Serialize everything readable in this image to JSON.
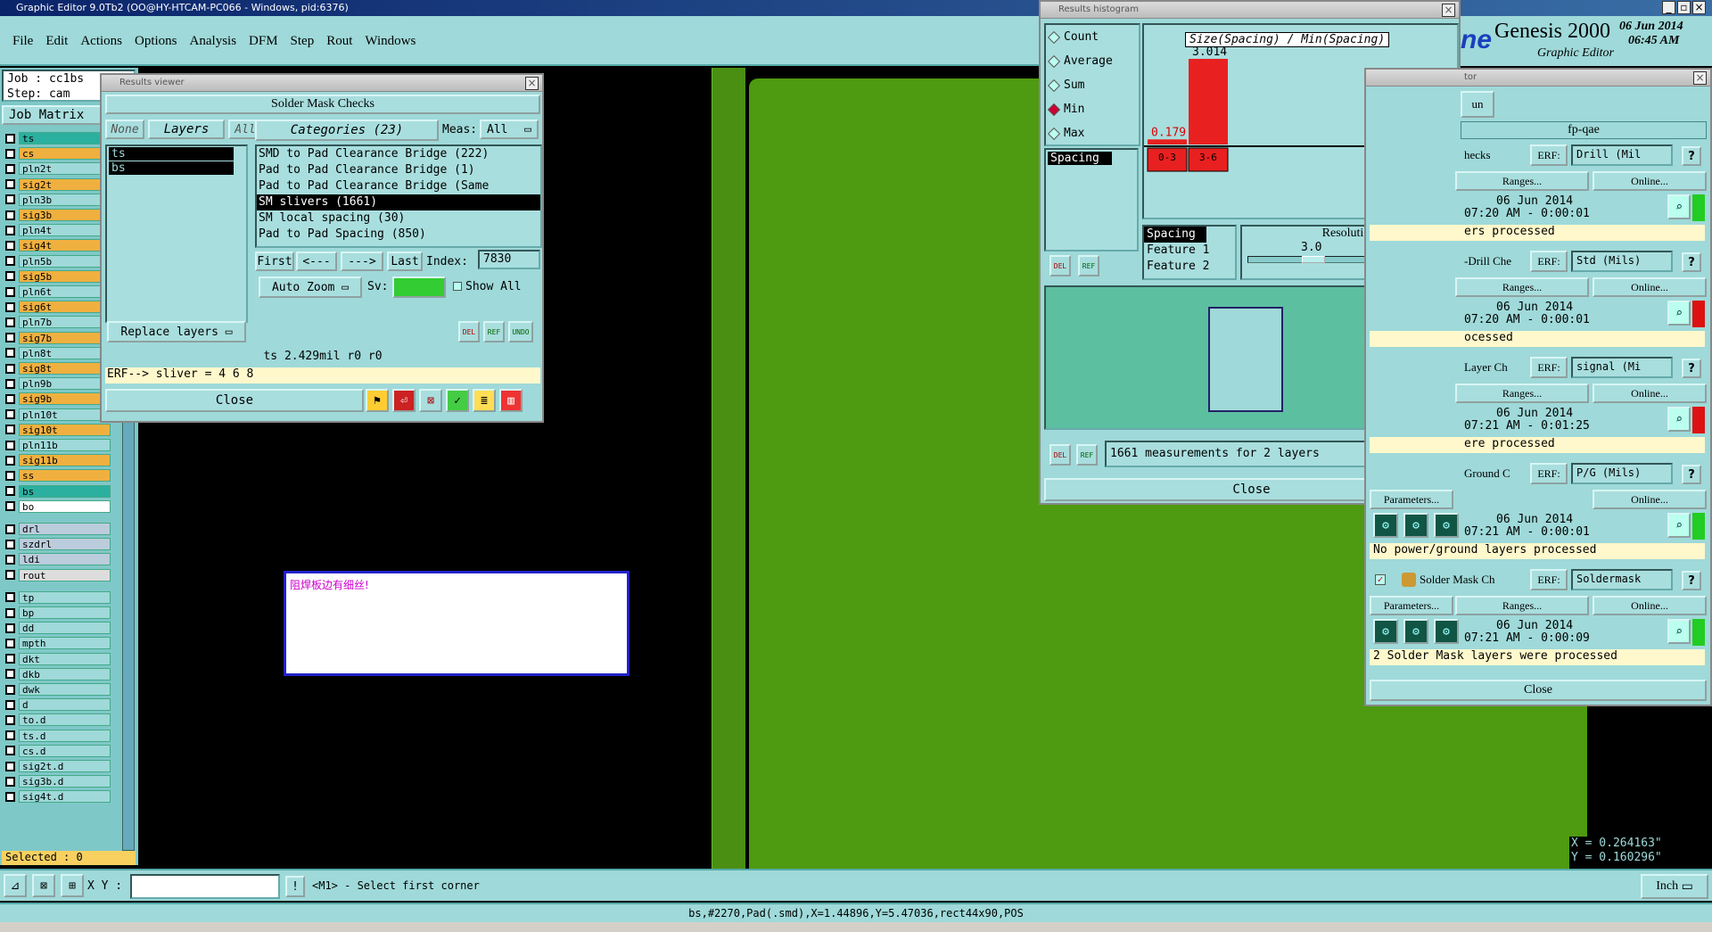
{
  "app_title": "Graphic Editor 9.0Tb2  (OO@HY-HTCAM-PC066 - Windows, pid:6376)",
  "menu": [
    "File",
    "Edit",
    "Actions",
    "Options",
    "Analysis",
    "DFM",
    "Step",
    "Rout",
    "Windows"
  ],
  "job": {
    "job_label": "Job : cc1bs",
    "step_label": "Step: cam",
    "matrix": "Job Matrix"
  },
  "layers": [
    {
      "name": "ts",
      "color": "#2bb0a0"
    },
    {
      "name": "cs",
      "color": "#f0b040"
    },
    {
      "name": "pln2t",
      "color": "#9fd9d9"
    },
    {
      "name": "sig2t",
      "color": "#f0b040"
    },
    {
      "name": "pln3b",
      "color": "#9fd9d9"
    },
    {
      "name": "sig3b",
      "color": "#f0b040"
    },
    {
      "name": "pln4t",
      "color": "#9fd9d9"
    },
    {
      "name": "sig4t",
      "color": "#f0b040"
    },
    {
      "name": "pln5b",
      "color": "#9fd9d9"
    },
    {
      "name": "sig5b",
      "color": "#f0b040"
    },
    {
      "name": "pln6t",
      "color": "#9fd9d9"
    },
    {
      "name": "sig6t",
      "color": "#f0b040"
    },
    {
      "name": "pln7b",
      "color": "#9fd9d9"
    },
    {
      "name": "sig7b",
      "color": "#f0b040"
    },
    {
      "name": "pln8t",
      "color": "#9fd9d9"
    },
    {
      "name": "sig8t",
      "color": "#f0b040"
    },
    {
      "name": "pln9b",
      "color": "#9fd9d9"
    },
    {
      "name": "sig9b",
      "color": "#f0b040"
    },
    {
      "name": "pln10t",
      "color": "#9fd9d9"
    },
    {
      "name": "sig10t",
      "color": "#f0b040"
    },
    {
      "name": "pln11b",
      "color": "#9fd9d9"
    },
    {
      "name": "sig11b",
      "color": "#f0b040"
    },
    {
      "name": "ss",
      "color": "#f0b040"
    },
    {
      "name": "bs",
      "color": "#2bb0a0"
    },
    {
      "name": "bo",
      "color": "#ffffff"
    },
    {
      "name": "drl",
      "color": "#bcd"
    },
    {
      "name": "szdrl",
      "color": "#bcd"
    },
    {
      "name": "ldi",
      "color": "#bcd"
    },
    {
      "name": "rout",
      "color": "#ddd"
    },
    {
      "name": "tp",
      "color": "#9fd9d9"
    },
    {
      "name": "bp",
      "color": "#9fd9d9"
    },
    {
      "name": "dd",
      "color": "#9fd9d9"
    },
    {
      "name": "mpth",
      "color": "#9fd9d9"
    },
    {
      "name": "dkt",
      "color": "#9fd9d9"
    },
    {
      "name": "dkb",
      "color": "#9fd9d9"
    },
    {
      "name": "dwk",
      "color": "#9fd9d9"
    },
    {
      "name": "d",
      "color": "#9fd9d9"
    },
    {
      "name": "to.d",
      "color": "#9fd9d9"
    },
    {
      "name": "ts.d",
      "color": "#9fd9d9"
    },
    {
      "name": "cs.d",
      "color": "#9fd9d9"
    },
    {
      "name": "sig2t.d",
      "color": "#9fd9d9"
    },
    {
      "name": "sig3b.d",
      "color": "#9fd9d9"
    },
    {
      "name": "sig4t.d",
      "color": "#9fd9d9"
    }
  ],
  "selected": "Selected : 0",
  "results_viewer": {
    "window_title": "Results viewer",
    "title": "Solder Mask Checks",
    "none": "None",
    "layers_label": "Layers",
    "all": "All",
    "categories": "Categories (23)",
    "meas_label": "Meas:",
    "meas_value": "All",
    "layer_list": [
      "ts",
      "bs"
    ],
    "category_list": [
      "SMD to Pad Clearance Bridge (222)",
      "Pad to Pad Clearance Bridge (1)",
      "Pad to Pad Clearance Bridge (Same",
      "SM slivers (1661)",
      "SM local spacing (30)",
      "Pad to Pad Spacing (850)"
    ],
    "first": "First",
    "prev": "<---",
    "next": "--->",
    "last": "Last",
    "index_label": "Index:",
    "index_value": "7830",
    "auto_zoom": "Auto Zoom",
    "sv_label": "Sv:",
    "show_all": "Show All",
    "replace_layers": "Replace layers",
    "status": "ts 2.429mil  r0  r0",
    "erf": "ERF--> sliver = 4 6 8",
    "close": "Close"
  },
  "note_text": "阻焊板边有细丝!",
  "histogram": {
    "window_title": "Results histogram",
    "options": [
      "Count",
      "Average",
      "Sum",
      "Min",
      "Max"
    ],
    "selected_option": "Min",
    "chart_title": "Size(Spacing) / Min(Spacing)",
    "bar_labels": [
      "0.179",
      "3.014"
    ],
    "bin_labels": [
      "0-3",
      "3-6"
    ],
    "list_item": "Spacing",
    "sub_list": [
      "Spacing",
      "Feature 1",
      "Feature 2"
    ],
    "resolution_label": "Resolution",
    "resolution_value": "3.0",
    "measurements": "1661 measurements for 2 layers",
    "close": "Close"
  },
  "brand": {
    "title": "Genesis 2000",
    "subtitle": "Graphic Editor",
    "date": "06 Jun 2014",
    "time": "06:45 AM",
    "logo": "ne"
  },
  "analyzer": {
    "title_fragment": "tor",
    "run": "un",
    "job": "fp-qae",
    "checks": [
      {
        "name": "hecks",
        "erf": "Drill (Mil",
        "date": "06 Jun 2014",
        "time": "07:20 AM - 0:00:01",
        "status": "ers processed",
        "btn": "Ranges...",
        "online": "Online..."
      },
      {
        "name": "-Drill Che",
        "erf": "Std (Mils)",
        "date": "06 Jun 2014",
        "time": "07:20 AM - 0:00:01",
        "status": "ocessed",
        "btn": "Ranges...",
        "online": "Online..."
      },
      {
        "name": "Layer Ch",
        "erf": "signal (Mi",
        "date": "06 Jun 2014",
        "time": "07:21 AM - 0:01:25",
        "status": "ere processed",
        "btn": "Ranges...",
        "online": "Online..."
      },
      {
        "name": "Ground C",
        "erf": "P/G (Mils)",
        "date": "06 Jun 2014",
        "time": "07:21 AM - 0:00:01",
        "status": "No power/ground layers processed",
        "btn": "Parameters...",
        "online": "Online..."
      },
      {
        "name": "Solder Mask Ch",
        "erf": "Soldermask",
        "date": "06 Jun 2014",
        "time": "07:21 AM - 0:00:09",
        "status": "2 Solder Mask layers were processed",
        "btn": "Parameters...",
        "ranges": "Ranges...",
        "online": "Online..."
      }
    ],
    "erf_label": "ERF:",
    "close": "Close"
  },
  "coords": {
    "x": "X = 0.264163\"",
    "y": "Y = 0.160296\""
  },
  "bottom": {
    "xy_label": "X Y :",
    "prompt": "<M1> - Select first corner",
    "units": "Inch",
    "status_line": "bs,#2270,Pad(.smd),X=1.44896,Y=5.47036,rect44x90,POS"
  }
}
